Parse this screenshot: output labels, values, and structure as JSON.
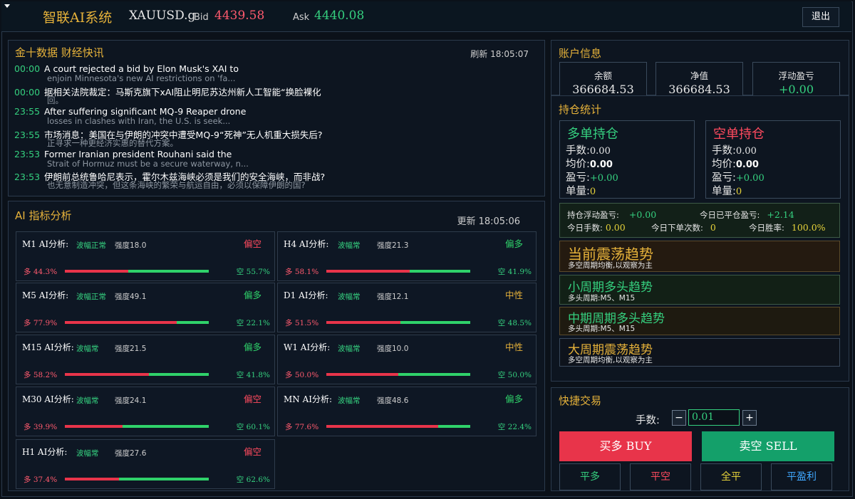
{
  "header": {
    "title": "智联AI系统",
    "symbol": "XAUUSD.g",
    "bid_label": "Bid",
    "bid_value": "4439.58",
    "ask_label": "Ask",
    "ask_value": "4440.08",
    "logout_label": "退出"
  },
  "news": {
    "title": "金十数据 财经快讯",
    "refresh": "刷新 18:05:07",
    "items": [
      {
        "time": "00:00",
        "text": "A court rejected a bid by Elon Musk's XAI to",
        "sub": "enjoin Minnesota's new AI restrictions on 'fa..."
      },
      {
        "time": "00:00",
        "text": "据相关法院裁定：马斯克旗下xAI阻止明尼苏达州新人工智能“换脸裸化",
        "sub": "回。"
      },
      {
        "time": "23:55",
        "text": "After suffering significant MQ-9 Reaper drone",
        "sub": "losses in clashes with Iran, the U.S. is seek..."
      },
      {
        "time": "23:55",
        "text": "市场消息：美国在与伊朗的冲突中遭受MQ-9“死神”无人机重大损失后?",
        "sub": "正寻求一种更经济实惠的替代方案。"
      },
      {
        "time": "23:53",
        "text": "Former Iranian president Rouhani said the",
        "sub": "Strait of Hormuz must be a secure waterway, n..."
      },
      {
        "time": "23:53",
        "text": "伊朗前总统鲁哈尼表示，霍尔木兹海峡必须是我们的安全海峡，而非战?",
        "sub": "也无意制造冲突，但这条海峡的繁荣与航运自由，必须以保障伊朗的国?"
      }
    ]
  },
  "ai": {
    "title": "AI 指标分析",
    "update": "更新 18:05:06",
    "colors": {
      "bull": "#e8344a",
      "bear": "#2fd26a",
      "neutral": "#e6b23a"
    },
    "cards": [
      {
        "title": "M1 AI分析:",
        "vol": "波幅正常",
        "strength": "强度18.0",
        "signal": "偏空",
        "signal_type": "bear",
        "bull": 44.3,
        "bull_label": "多 44.3%",
        "bear_label": "空 55.7%"
      },
      {
        "title": "H4 AI分析:",
        "vol": "波幅常",
        "strength": "强度21.3",
        "signal": "偏多",
        "signal_type": "bull",
        "bull": 58.1,
        "bull_label": "多 58.1%",
        "bear_label": "空 41.9%"
      },
      {
        "title": "M5 AI分析:",
        "vol": "波幅正常",
        "strength": "强度49.1",
        "signal": "偏多",
        "signal_type": "bull",
        "bull": 77.9,
        "bull_label": "多 77.9%",
        "bear_label": "空 22.1%"
      },
      {
        "title": "D1 AI分析:",
        "vol": "波幅常",
        "strength": "强度12.1",
        "signal": "中性",
        "signal_type": "neutral",
        "bull": 51.5,
        "bull_label": "多 51.5%",
        "bear_label": "空 48.5%"
      },
      {
        "title": "M15 AI分析:",
        "vol": "波幅常",
        "strength": "强度21.5",
        "signal": "偏多",
        "signal_type": "bull",
        "bull": 58.2,
        "bull_label": "多 58.2%",
        "bear_label": "空 41.8%"
      },
      {
        "title": "W1 AI分析:",
        "vol": "波幅常",
        "strength": "强度10.0",
        "signal": "中性",
        "signal_type": "neutral",
        "bull": 50.0,
        "bull_label": "多 50.0%",
        "bear_label": "空 50.0%"
      },
      {
        "title": "M30 AI分析:",
        "vol": "波幅常",
        "strength": "强度24.1",
        "signal": "偏空",
        "signal_type": "bear",
        "bull": 39.9,
        "bull_label": "多 39.9%",
        "bear_label": "空 60.1%"
      },
      {
        "title": "MN AI分析:",
        "vol": "波幅常",
        "strength": "强度48.6",
        "signal": "偏多",
        "signal_type": "bull",
        "bull": 77.6,
        "bull_label": "多 77.6%",
        "bear_label": "空 22.4%"
      },
      {
        "title": "H1 AI分析:",
        "vol": "波幅常",
        "strength": "强度27.6",
        "signal": "偏空",
        "signal_type": "bear",
        "bull": 37.4,
        "bull_label": "多 37.4%",
        "bear_label": "空 62.6%"
      }
    ]
  },
  "account": {
    "title": "账户信息",
    "balance_label": "余额",
    "balance": "366684.53",
    "equity_label": "净值",
    "equity": "366684.53",
    "float_label": "浮动盈亏",
    "float": "+0.00"
  },
  "positions": {
    "title": "持仓统计",
    "long": {
      "header": "多单持仓",
      "lots_label": "手数:",
      "lots": "0.00",
      "avg_label": "均价:",
      "avg": "0.00",
      "pnl_label": "盈亏:",
      "pnl": "+0.00",
      "unit_label": "单量:",
      "unit": "0"
    },
    "short": {
      "header": "空单持仓",
      "lots_label": "手数:",
      "lots": "0.00",
      "avg_label": "均价:",
      "avg": "0.00",
      "pnl_label": "盈亏:",
      "pnl": "+0.00",
      "unit_label": "单量:",
      "unit": "0"
    },
    "stats": {
      "float_label": "持仓浮动盈亏:",
      "float": "+0.00",
      "closed_label": "今日已平仓盈亏:",
      "closed": "+2.14",
      "lots_label": "今日手数:",
      "lots": "0.00",
      "orders_label": "今日下单次数:",
      "orders": "0",
      "winrate_label": "今日胜率:",
      "winrate": "100.0%"
    }
  },
  "trends": [
    {
      "title": "当前震荡趋势",
      "sub": "多空周期均衡,以观察为主",
      "color": "#e6b23a"
    },
    {
      "title": "小周期多头趋势",
      "sub": "多头周期:M5、M15",
      "color": "#35d07f"
    },
    {
      "title": "中期周期多头趋势",
      "sub": "多头周期:M5、M15",
      "color": "#35d07f"
    },
    {
      "title": "大周期震荡趋势",
      "sub": "多空周期均衡,以观察为主",
      "color": "#e6b23a"
    }
  ],
  "trade": {
    "title": "快捷交易",
    "lots_label": "手数:",
    "minus": "−",
    "plus": "+",
    "lots_value": "0.01",
    "buy_label": "买多 BUY",
    "sell_label": "卖空 SELL",
    "close_long": "平多",
    "close_short": "平空",
    "close_all": "全平",
    "close_profit": "平盈利"
  }
}
